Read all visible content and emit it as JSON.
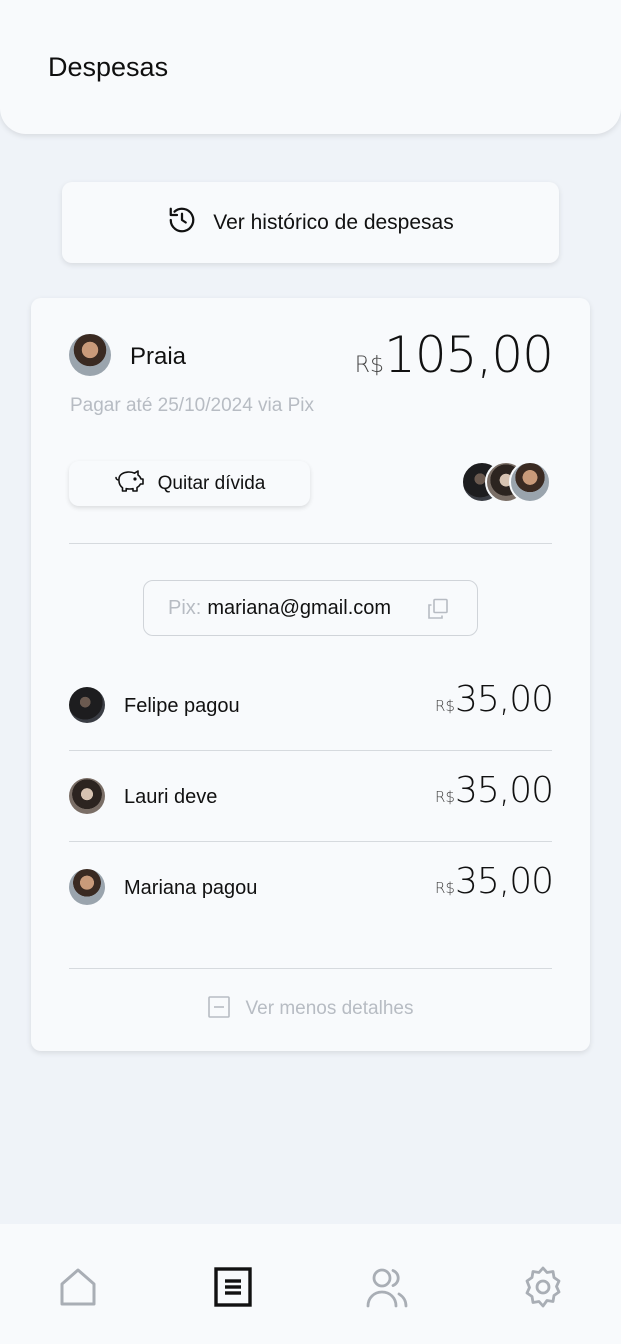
{
  "header": {
    "title": "Despesas"
  },
  "history_button": {
    "label": "Ver histórico de despesas",
    "icon": "history-icon"
  },
  "expense": {
    "name": "Praia",
    "currency": "R$",
    "amount": "105,00",
    "due_text": "Pagar até 25/10/2024 via Pix",
    "pay_button": {
      "label": "Quitar dívida",
      "icon": "piggy-bank-icon"
    },
    "pix": {
      "prefix": "Pix:",
      "value": "mariana@gmail.com",
      "icon": "copy-icon"
    },
    "participants": [
      {
        "label": "Felipe pagou",
        "currency": "R$",
        "amount": "35,00"
      },
      {
        "label": "Lauri deve",
        "currency": "R$",
        "amount": "35,00"
      },
      {
        "label": "Mariana pagou",
        "currency": "R$",
        "amount": "35,00"
      }
    ],
    "toggle_details": {
      "label": "Ver menos detalhes",
      "icon": "minus-square-icon"
    }
  },
  "nav": {
    "items": [
      {
        "icon": "home-icon",
        "active": false
      },
      {
        "icon": "document-icon",
        "active": true
      },
      {
        "icon": "users-icon",
        "active": false
      },
      {
        "icon": "gear-icon",
        "active": false
      }
    ]
  },
  "colors": {
    "background": "#eff3f8",
    "surface": "#f8fafc",
    "muted": "#b7bcc3",
    "text": "#111111"
  }
}
